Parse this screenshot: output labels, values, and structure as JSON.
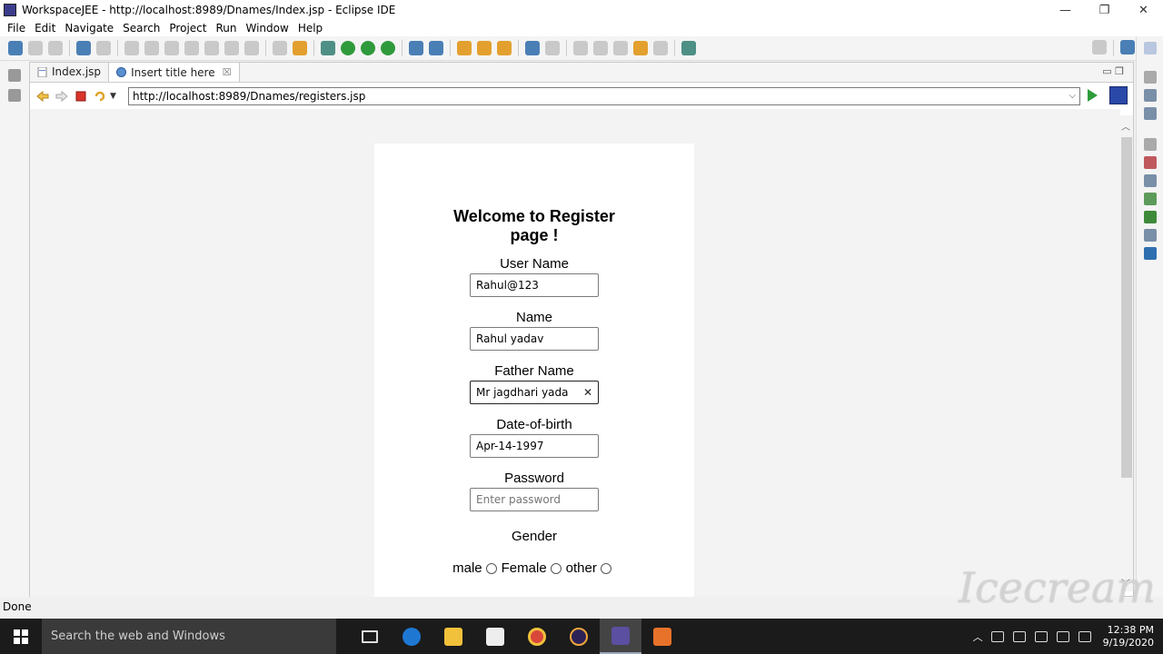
{
  "window": {
    "title": "WorkspaceJEE - http://localhost:8989/Dnames/Index.jsp - Eclipse IDE",
    "minimize": "—",
    "restore": "❐",
    "close": "✕"
  },
  "menu": [
    "File",
    "Edit",
    "Navigate",
    "Search",
    "Project",
    "Run",
    "Window",
    "Help"
  ],
  "tabs": [
    {
      "label": "Index.jsp",
      "active": false
    },
    {
      "label": "Insert title here",
      "active": true,
      "close": "☒"
    }
  ],
  "tab_controls": "▭  ❐",
  "browser": {
    "url": "http://localhost:8989/Dnames/registers.jsp",
    "url_dropdown": "⌵"
  },
  "form": {
    "heading": "Welcome to Register page !",
    "fields": [
      {
        "label": "User Name",
        "value": "Rahul@123",
        "placeholder": ""
      },
      {
        "label": "Name",
        "value": "Rahul yadav",
        "placeholder": ""
      },
      {
        "label": "Father Name",
        "value": "Mr jagdhari yada",
        "placeholder": "",
        "clear": "✕"
      },
      {
        "label": "Date-of-birth",
        "value": "Apr-14-1997",
        "placeholder": ""
      },
      {
        "label": "Password",
        "value": "",
        "placeholder": "Enter password"
      }
    ],
    "gender_label": "Gender",
    "gender_options": [
      "male",
      "Female",
      "other"
    ]
  },
  "scroll": {
    "up": "︿",
    "down": "﹀"
  },
  "status": "Done",
  "taskbar": {
    "search_placeholder": "Search the web and Windows",
    "time": "12:38 PM",
    "date": "9/19/2020"
  },
  "watermark": "Icecream",
  "colors": {
    "go_button": "#2e9c3a",
    "taskbar": "#1b1b1b",
    "taskbar_search": "#3a3a3a"
  },
  "icons": [
    "back-icon",
    "forward-icon",
    "stop-icon",
    "refresh-icon",
    "go-icon",
    "browser-icon",
    "search-icon"
  ]
}
